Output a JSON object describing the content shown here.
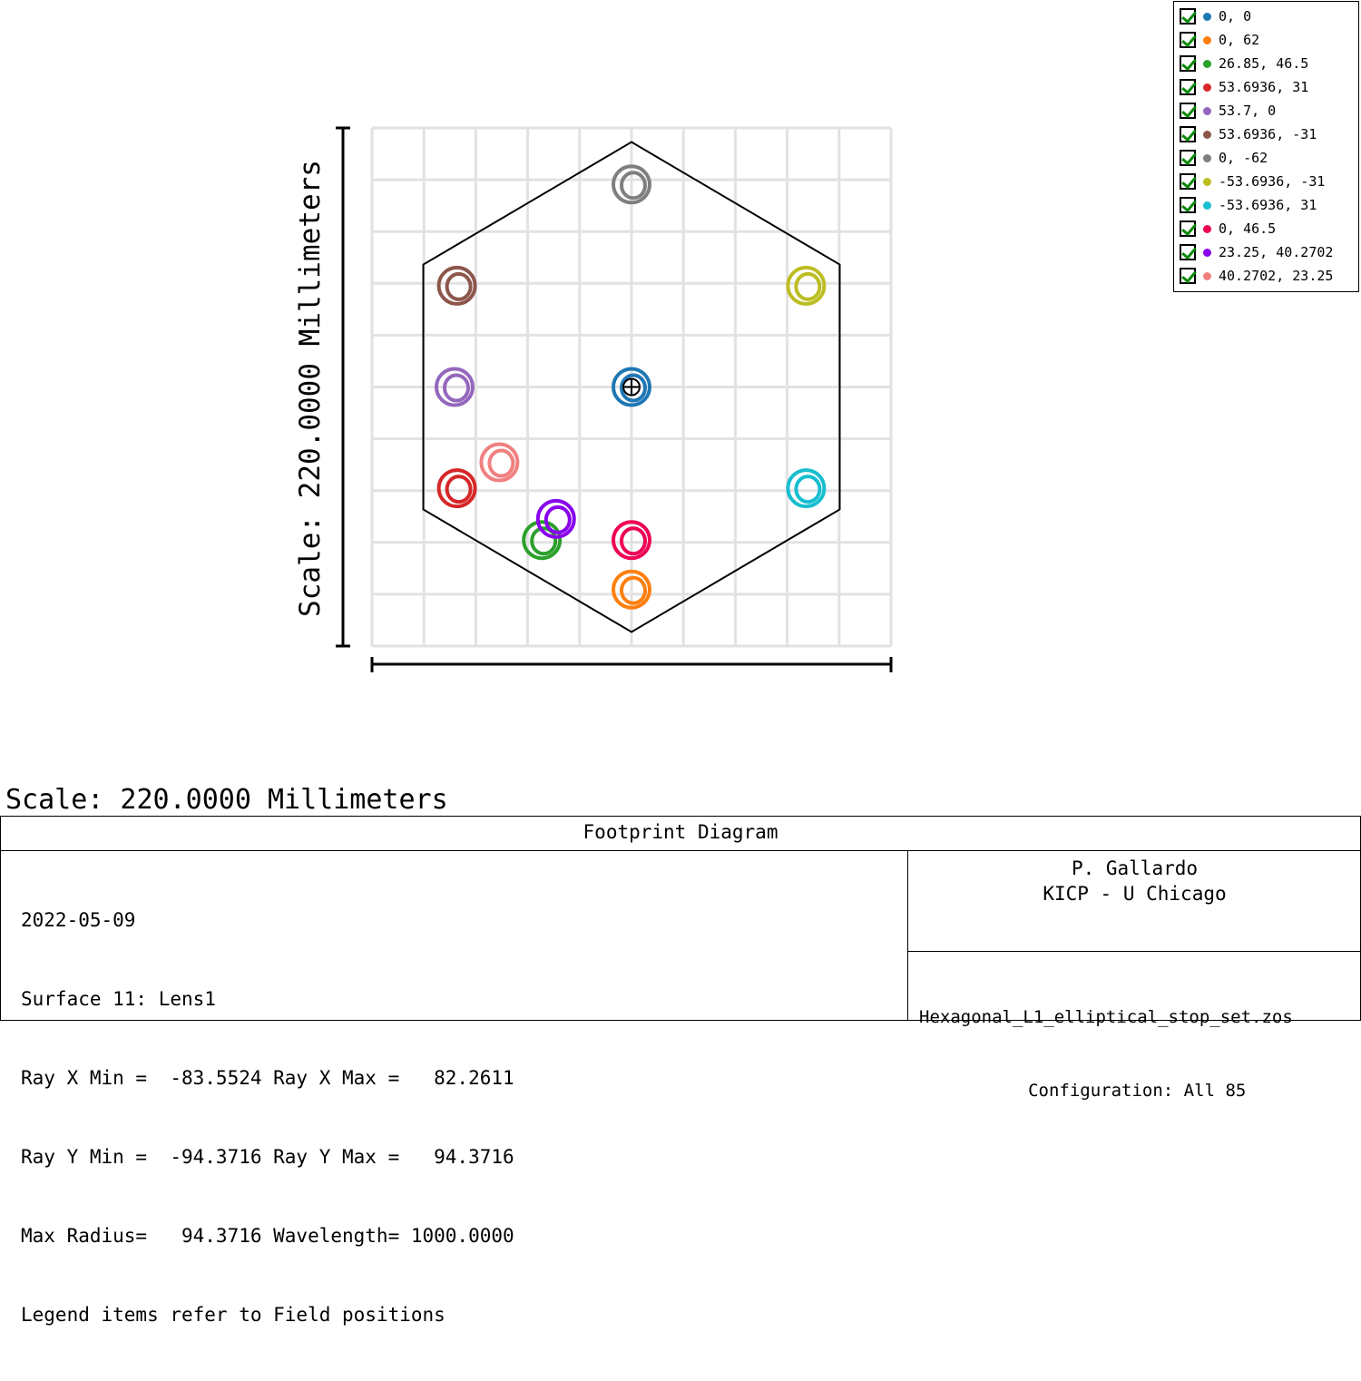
{
  "chart_data": {
    "type": "scatter",
    "xlim": [
      -110,
      110
    ],
    "ylim": [
      -110,
      110
    ],
    "grid": true,
    "y_axis_label": "Scale: 220.0000 Millimeters",
    "hexagon": {
      "circumradius_mm": 104,
      "orientation": "pointy-top"
    },
    "chief_ray_marker": {
      "x": 0,
      "y": 0
    },
    "series": [
      {
        "name": "0, 0",
        "color": "#1f77b4",
        "x": 0,
        "y": 0
      },
      {
        "name": "0, 62",
        "color": "#ff7f0e",
        "x": 0,
        "y": -86
      },
      {
        "name": "26.85, 46.5",
        "color": "#2ca02c",
        "x": -38,
        "y": -65
      },
      {
        "name": "53.6936, 31",
        "color": "#d62728",
        "x": -74,
        "y": -43
      },
      {
        "name": "53.7, 0",
        "color": "#9467bd",
        "x": -75,
        "y": 0
      },
      {
        "name": "53.6936, -31",
        "color": "#8c564b",
        "x": -74,
        "y": 43
      },
      {
        "name": "0, -62",
        "color": "#7f7f7f",
        "x": 0,
        "y": 86
      },
      {
        "name": "-53.6936, -31",
        "color": "#bcbd22",
        "x": 74,
        "y": 43
      },
      {
        "name": "-53.6936, 31",
        "color": "#17becf",
        "x": 74,
        "y": -43
      },
      {
        "name": "0, 46.5",
        "color": "#ee0055",
        "x": 0,
        "y": -65
      },
      {
        "name": "23.25, 40.2702",
        "color": "#8800ee",
        "x": -32,
        "y": -56
      },
      {
        "name": "40.2702, 23.25",
        "color": "#f08080",
        "x": -56,
        "y": -32
      }
    ]
  },
  "scale_label": "Scale: 220.0000 Millimeters",
  "footer": {
    "title": "Footprint Diagram",
    "info_lines": [
      "2022-05-09",
      "Surface 11: Lens1",
      "Ray X Min =  -83.5524 Ray X Max =   82.2611",
      "Ray Y Min =  -94.3716 Ray Y Max =   94.3716",
      "Max Radius=   94.3716 Wavelength= 1000.0000",
      "Legend items refer to Field positions"
    ],
    "author_name": "P. Gallardo",
    "author_org": "KICP - U Chicago",
    "file_name": "Hexagonal_L1_elliptical_stop_set.zos",
    "configuration": "      Configuration: All 85"
  }
}
